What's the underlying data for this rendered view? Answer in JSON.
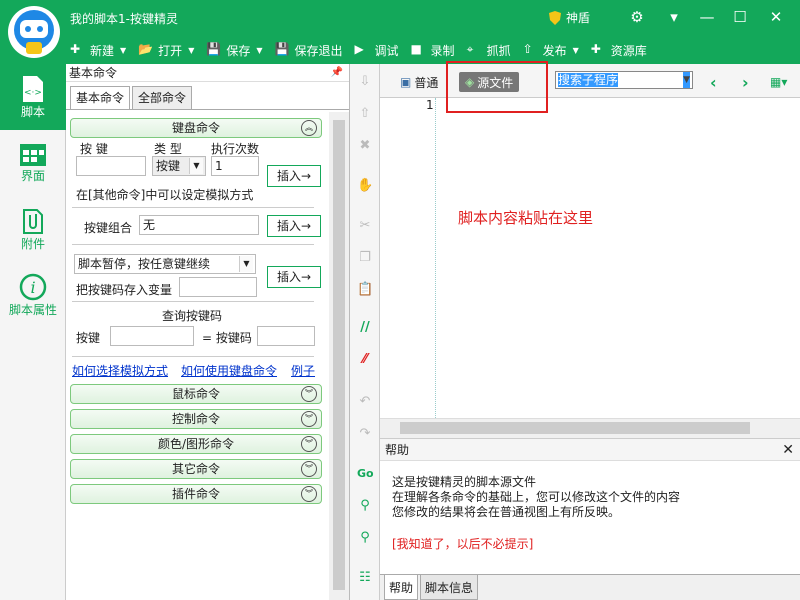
{
  "window": {
    "title": "我的脚本1-按键精灵",
    "shield_label": "神盾"
  },
  "toolbar": [
    {
      "icon": "plus-icon",
      "label": "新建",
      "dropdown": true
    },
    {
      "icon": "folder-open-icon",
      "label": "打开",
      "dropdown": true
    },
    {
      "icon": "save-icon",
      "label": "保存",
      "dropdown": true
    },
    {
      "icon": "save-exit-icon",
      "label": "保存退出",
      "dropdown": false
    },
    {
      "icon": "debug-icon",
      "label": "调试",
      "dropdown": false
    },
    {
      "icon": "record-icon",
      "label": "录制",
      "dropdown": false
    },
    {
      "icon": "capture-icon",
      "label": "抓抓",
      "dropdown": false
    },
    {
      "icon": "publish-icon",
      "label": "发布",
      "dropdown": true
    },
    {
      "icon": "library-icon",
      "label": "资源库",
      "dropdown": false
    }
  ],
  "nav": [
    {
      "icon": "script-icon",
      "label": "脚本",
      "active": true
    },
    {
      "icon": "interface-icon",
      "label": "界面",
      "active": false
    },
    {
      "icon": "attachment-icon",
      "label": "附件",
      "active": false
    },
    {
      "icon": "info-icon",
      "label": "脚本属性",
      "active": false
    }
  ],
  "panel": {
    "header": "基本命令",
    "tabs": [
      "基本命令",
      "全部命令"
    ],
    "keyboard": {
      "title": "键盘命令",
      "col_key": "按 键",
      "col_type": "类 型",
      "col_times": "执行次数",
      "type_value": "按键",
      "times_value": "1",
      "insert_label": "插入→",
      "note": "在[其他命令]中可以设定模拟方式",
      "combo_label": "按键组合",
      "combo_value": "无",
      "pause_value": "脚本暂停，按任意键继续",
      "store_label": "把按键码存入变量",
      "query_title": "查询按键码",
      "query_key_label": "按键",
      "query_code_label": "= 按键码"
    },
    "links": [
      "如何选择模拟方式",
      "如何使用键盘命令",
      "例子"
    ],
    "groups": [
      "鼠标命令",
      "控制命令",
      "颜色/图形命令",
      "其它命令",
      "插件命令"
    ]
  },
  "editor": {
    "tab_normal": "普通",
    "tab_source": "源文件",
    "search_placeholder": "搜索子程序",
    "line_number": "1",
    "annotation": "脚本内容粘贴在这里"
  },
  "help": {
    "title": "帮助",
    "lines": [
      "这是按键精灵的脚本源文件",
      "在理解各条命令的基础上，您可以修改这个文件的内容",
      "您修改的结果将会在普通视图上有所反映。"
    ],
    "dismiss": "[我知道了，以后不必提示]",
    "tabs": [
      "帮助",
      "脚本信息"
    ]
  },
  "colors": {
    "brand": "#13a85a",
    "highlight": "#e02020"
  }
}
